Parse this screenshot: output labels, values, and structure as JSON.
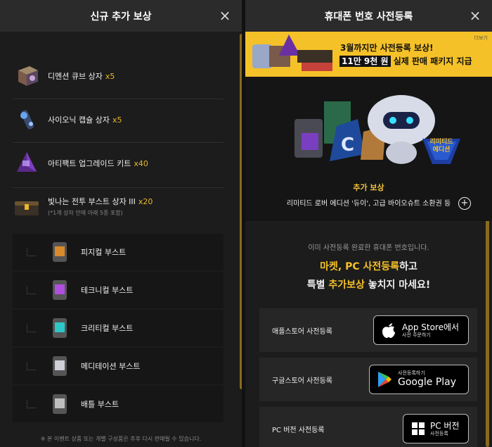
{
  "left": {
    "title": "신규 추가 보상",
    "items": [
      {
        "label": "디멘션 큐브 상자",
        "qty": "x5"
      },
      {
        "label": "사이오닉 캡슐 상자",
        "qty": "x5"
      },
      {
        "label": "아티팩트 업그레이드 키트",
        "qty": "x40"
      },
      {
        "label": "빛나는 전투 부스트 상자 III",
        "qty": "x20",
        "note": "(*1개 상자 안에 아래 5종 포함)"
      }
    ],
    "sub_items": [
      {
        "label": "피지컬 부스트",
        "color": "#d98a2a"
      },
      {
        "label": "테크니컬 부스트",
        "color": "#b04ee0"
      },
      {
        "label": "크리티컬 부스트",
        "color": "#2ec7c9"
      },
      {
        "label": "메디테이션 부스트",
        "color": "#cfcfd8"
      },
      {
        "label": "배틀 부스트",
        "color": "#bfbfbf"
      }
    ],
    "footer_note": "※ 본 이벤트 상품 또는 개별 구성품은 추후 다시 판매될 수 있습니다."
  },
  "right": {
    "title": "휴대폰 번호 사전등록",
    "banner": {
      "more": "더보기",
      "line1": "3월까지만 사전등록 보상!",
      "line2_price": "11만 9천 원",
      "line2_rest": " 실제 판매 패키지 지급"
    },
    "badge": {
      "line1": "리미티드",
      "line2": "에디션"
    },
    "reward_title": "추가 보상",
    "reward_desc": "리미티드 로버 에디션 '듀이', 고급 바이오슈트 소환권 등",
    "plus": "+",
    "info1": "이미 사전등록 완료한 휴대폰 번호입니다.",
    "info2_hl": "마켓, PC 사전등록",
    "info2_rest": "하고",
    "info3_a": "특별 ",
    "info3_hl": "추가보상",
    "info3_b": " 놓치지 마세요!",
    "stores": [
      {
        "label": "애플스토어 사전등록",
        "btn_big": "App Store에서",
        "btn_small": "사전 주문하기"
      },
      {
        "label": "구글스토어 사전등록",
        "btn_small": "사전등록하기",
        "btn_big": "Google Play"
      },
      {
        "label": "PC 버전 사전등록",
        "btn_big": "PC 버전",
        "btn_small": "사전등록"
      }
    ]
  },
  "close_icon": "×",
  "colors": {
    "accent": "#f5c128",
    "panel": "#1c1c1c",
    "header": "#2b2b2b"
  }
}
